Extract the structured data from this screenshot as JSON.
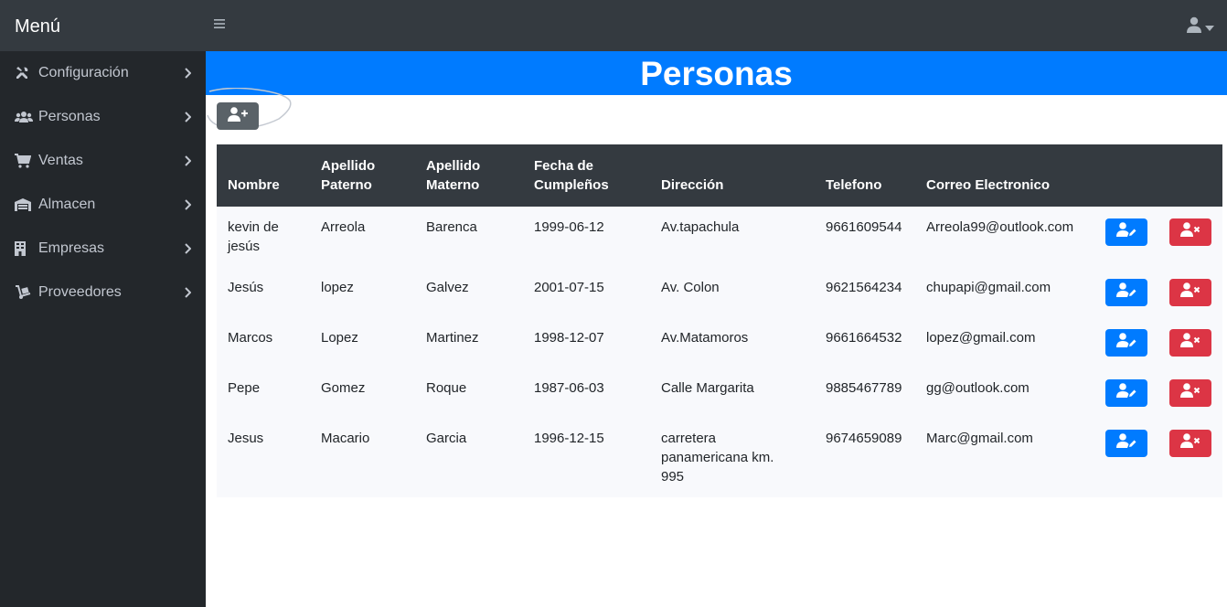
{
  "sidebar": {
    "brand": "Menú",
    "items": [
      {
        "label": "Configuración",
        "icon": "tools-icon"
      },
      {
        "label": "Personas",
        "icon": "users-icon"
      },
      {
        "label": "Ventas",
        "icon": "cart-icon"
      },
      {
        "label": "Almacen",
        "icon": "warehouse-icon"
      },
      {
        "label": "Empresas",
        "icon": "building-icon"
      },
      {
        "label": "Proveedores",
        "icon": "dolly-icon"
      }
    ]
  },
  "page": {
    "title": "Personas"
  },
  "table": {
    "headers": {
      "nombre": "Nombre",
      "apellido_paterno": [
        "Apellido",
        "Paterno"
      ],
      "apellido_materno": [
        "Apellido",
        "Materno"
      ],
      "fecha": [
        "Fecha de",
        "Cumpleños"
      ],
      "direccion": "Dirección",
      "telefono": "Telefono",
      "correo": "Correo Electronico"
    },
    "rows": [
      {
        "nombre": [
          "kevin de",
          "jesús"
        ],
        "paterno": "Arreola",
        "materno": "Barenca",
        "fecha": "1999-06-12",
        "direccion": [
          "Av.tapachula"
        ],
        "telefono": "9661609544",
        "correo": "Arreola99@outlook.com"
      },
      {
        "nombre": [
          "Jesús"
        ],
        "paterno": "lopez",
        "materno": "Galvez",
        "fecha": "2001-07-15",
        "direccion": [
          "Av. Colon"
        ],
        "telefono": "9621564234",
        "correo": "chupapi@gmail.com"
      },
      {
        "nombre": [
          "Marcos"
        ],
        "paterno": "Lopez",
        "materno": "Martinez",
        "fecha": "1998-12-07",
        "direccion": [
          "Av.Matamoros"
        ],
        "telefono": "9661664532",
        "correo": "lopez@gmail.com"
      },
      {
        "nombre": [
          "Pepe"
        ],
        "paterno": "Gomez",
        "materno": "Roque",
        "fecha": "1987-06-03",
        "direccion": [
          "Calle Margarita"
        ],
        "telefono": "9885467789",
        "correo": "gg@outlook.com"
      },
      {
        "nombre": [
          "Jesus"
        ],
        "paterno": "Macario",
        "materno": "Garcia",
        "fecha": "1996-12-15",
        "direccion": [
          "carretera",
          "panamericana km.",
          "995"
        ],
        "telefono": "9674659089",
        "correo": "Marc@gmail.com"
      }
    ]
  },
  "colors": {
    "primary": "#007bff",
    "danger": "#dc3545",
    "dark": "#343a40",
    "sidebar": "#23272b",
    "secondary": "#5a6268"
  }
}
